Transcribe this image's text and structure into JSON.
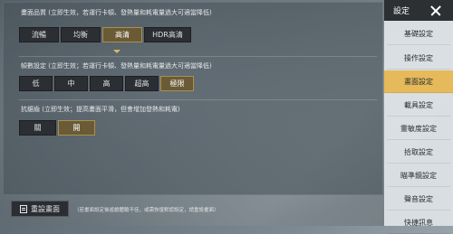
{
  "settings": {
    "graphics_quality": {
      "title": "畫面品質 (立即生效，若運行卡頓、發熱量和耗電量過大可適當降低)",
      "options": [
        "流暢",
        "均衡",
        "高清",
        "HDR高清"
      ],
      "selected": "高清"
    },
    "frame_rate": {
      "title": "幀數設定 (立即生效；若運行卡頓、發熱量和耗電量過大可適當降低)",
      "options": [
        "低",
        "中",
        "高",
        "超高",
        "極限"
      ],
      "selected": "極限"
    },
    "anti_aliasing": {
      "title": "抗鋸齒 (立即生效；提高畫面平滑，但會增加發熱和耗電)",
      "options": [
        "關",
        "開"
      ],
      "selected": "開"
    }
  },
  "bottom": {
    "reset_label": "重設畫面",
    "hint": "（若畫面設定後遊戲體驗不佳，或需恢復默認設定，請重設畫面）"
  },
  "sidebar": {
    "title": "設定",
    "items": [
      {
        "label": "基礎設定",
        "active": false
      },
      {
        "label": "操作設定",
        "active": false
      },
      {
        "label": "畫面設定",
        "active": true
      },
      {
        "label": "載具設定",
        "active": false
      },
      {
        "label": "靈敏度設定",
        "active": false
      },
      {
        "label": "拾取設定",
        "active": false
      },
      {
        "label": "瞄準鏡設定",
        "active": false
      },
      {
        "label": "聲音設定",
        "active": false
      },
      {
        "label": "快捷訊息",
        "active": false
      }
    ]
  },
  "colors": {
    "accent": "#e6b95a",
    "selected_option": "#6a5b36",
    "option_bg": "#2b2f33"
  }
}
